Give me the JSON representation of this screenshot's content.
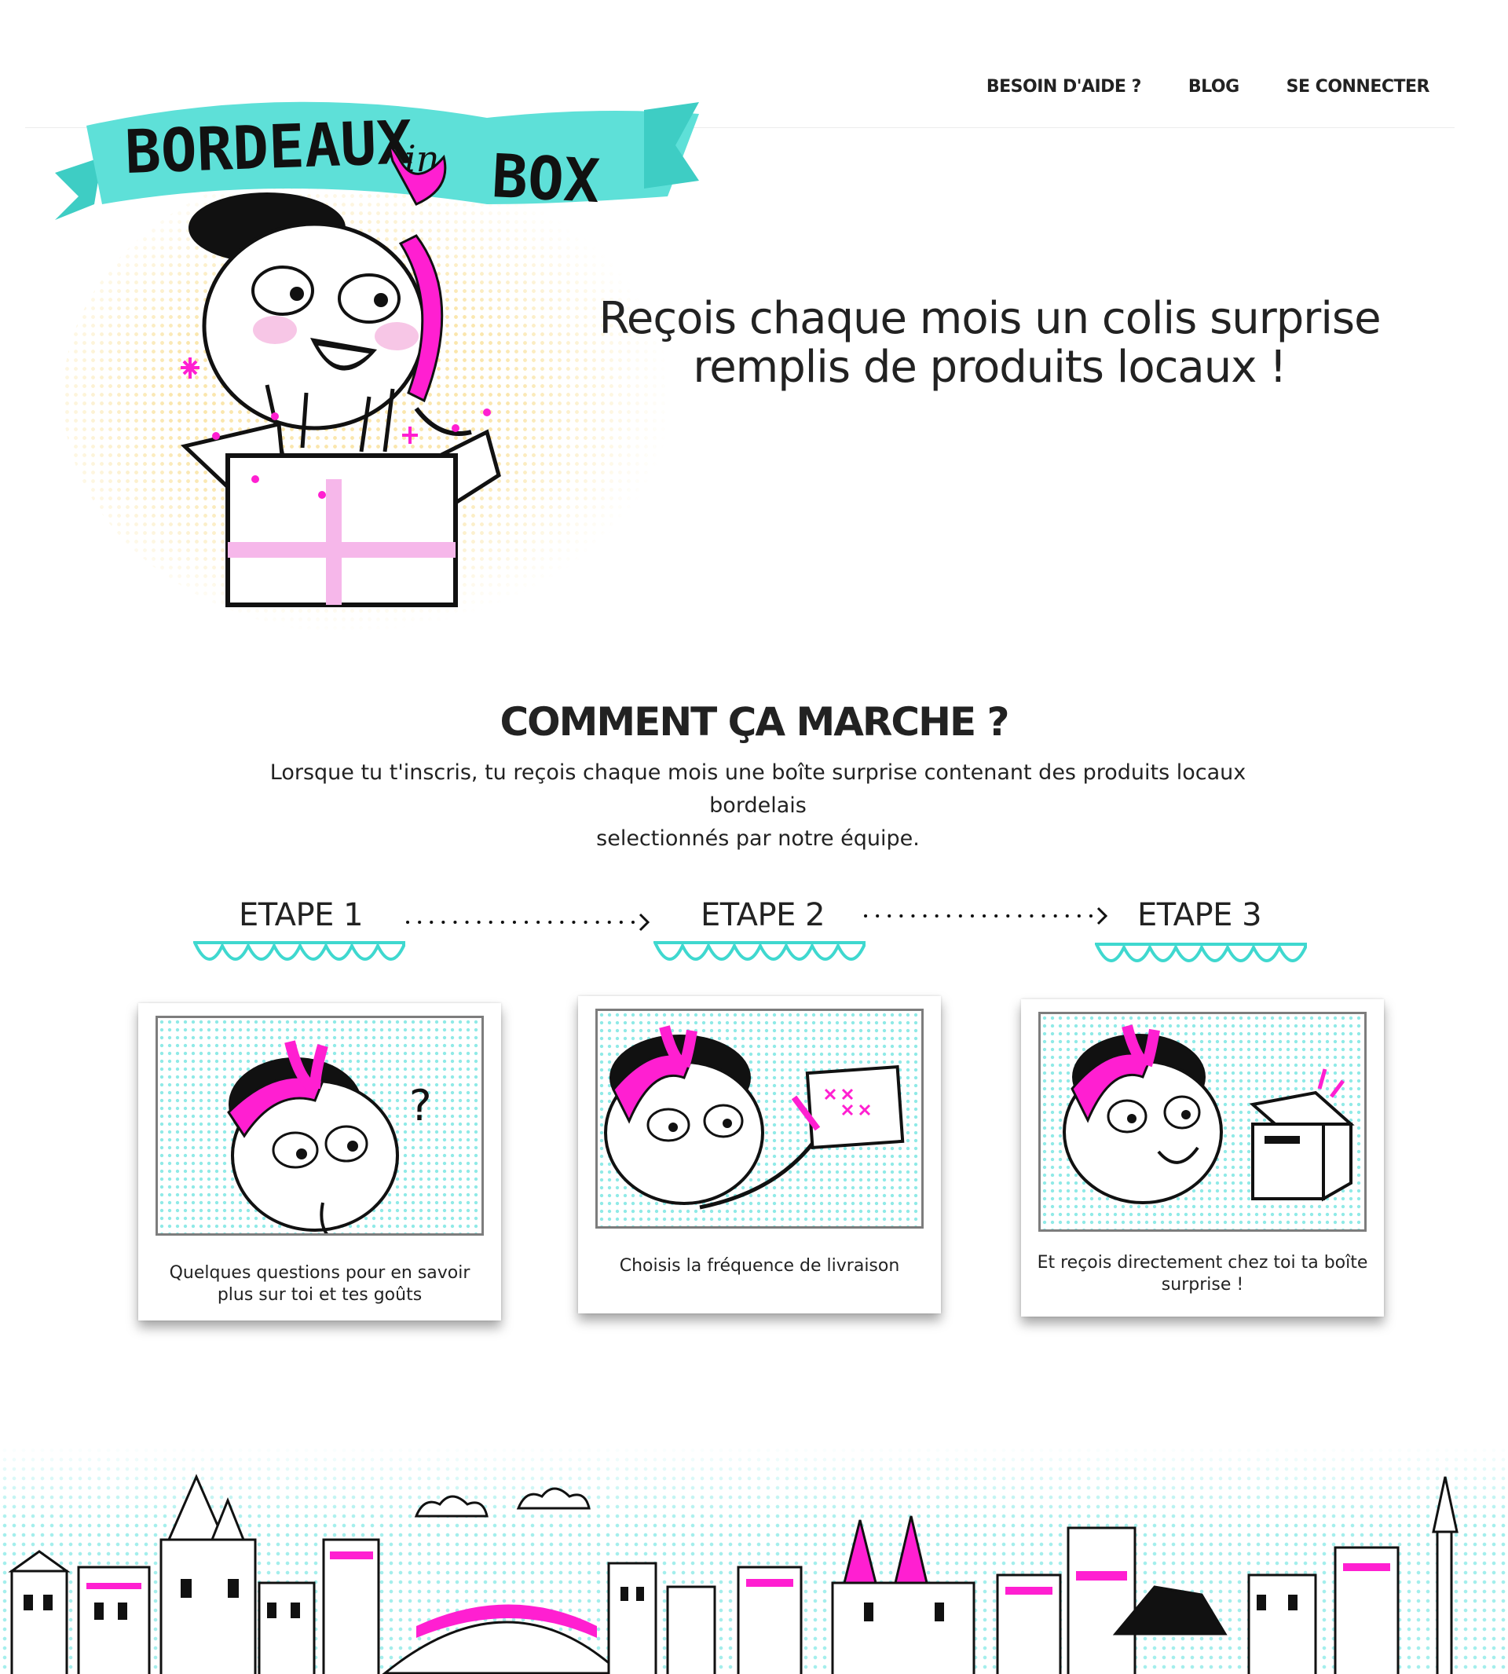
{
  "header": {
    "logo_text": "BORDEAUX in BOX",
    "nav": [
      {
        "label": "BESOIN D'AIDE ?"
      },
      {
        "label": "BLOG"
      },
      {
        "label": "SE CONNECTER"
      }
    ]
  },
  "hero": {
    "tagline_line1": "Reçois chaque mois un colis surprise",
    "tagline_line2": "remplis de produits locaux !"
  },
  "how": {
    "title": "COMMENT ÇA MARCHE ?",
    "desc_line1": "Lorsque tu t'inscris, tu reçois chaque mois une boîte surprise contenant des produits locaux bordelais",
    "desc_line2": "selectionnés par notre équipe.",
    "steps": [
      {
        "label": "ETAPE 1",
        "caption": "Quelques questions pour en savoir plus sur toi et tes goûts"
      },
      {
        "label": "ETAPE 2",
        "caption": "Choisis la fréquence de livraison"
      },
      {
        "label": "ETAPE 3",
        "caption": "Et reçois directement chez toi ta boîte surprise !"
      }
    ]
  },
  "colors": {
    "turquoise": "#46dcd5",
    "magenta": "#ff1fd1",
    "yellow_dots": "#f5cd5a",
    "text": "#222222"
  }
}
